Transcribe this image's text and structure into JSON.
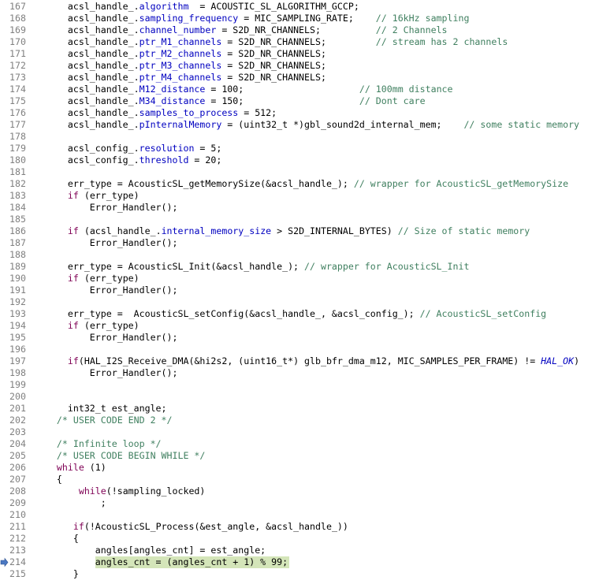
{
  "editor": {
    "active_line": "214",
    "lines": [
      {
        "num": "167",
        "tokens": [
          [
            "      acsl_handle_.",
            "plain"
          ],
          [
            "algorithm",
            "field"
          ],
          [
            "  = ACOUSTIC_SL_ALGORITHM_GCCP;",
            "plain"
          ]
        ]
      },
      {
        "num": "168",
        "tokens": [
          [
            "      acsl_handle_.",
            "plain"
          ],
          [
            "sampling_frequency",
            "field"
          ],
          [
            " = MIC_SAMPLING_RATE;    ",
            "plain"
          ],
          [
            "// 16kHz sampling",
            "comment"
          ]
        ]
      },
      {
        "num": "169",
        "tokens": [
          [
            "      acsl_handle_.",
            "plain"
          ],
          [
            "channel_number",
            "field"
          ],
          [
            " = S2D_NR_CHANNELS;          ",
            "plain"
          ],
          [
            "// 2 Channels",
            "comment"
          ]
        ]
      },
      {
        "num": "170",
        "tokens": [
          [
            "      acsl_handle_.",
            "plain"
          ],
          [
            "ptr_M1_channels",
            "field"
          ],
          [
            " = S2D_NR_CHANNELS;         ",
            "plain"
          ],
          [
            "// stream has 2 channels",
            "comment"
          ]
        ]
      },
      {
        "num": "171",
        "tokens": [
          [
            "      acsl_handle_.",
            "plain"
          ],
          [
            "ptr_M2_channels",
            "field"
          ],
          [
            " = S2D_NR_CHANNELS;",
            "plain"
          ]
        ]
      },
      {
        "num": "172",
        "tokens": [
          [
            "      acsl_handle_.",
            "plain"
          ],
          [
            "ptr_M3_channels",
            "field"
          ],
          [
            " = S2D_NR_CHANNELS;",
            "plain"
          ]
        ]
      },
      {
        "num": "173",
        "tokens": [
          [
            "      acsl_handle_.",
            "plain"
          ],
          [
            "ptr_M4_channels",
            "field"
          ],
          [
            " = S2D_NR_CHANNELS;",
            "plain"
          ]
        ]
      },
      {
        "num": "174",
        "tokens": [
          [
            "      acsl_handle_.",
            "plain"
          ],
          [
            "M12_distance",
            "field"
          ],
          [
            " = 100;                     ",
            "plain"
          ],
          [
            "// 100mm distance",
            "comment"
          ]
        ]
      },
      {
        "num": "175",
        "tokens": [
          [
            "      acsl_handle_.",
            "plain"
          ],
          [
            "M34_distance",
            "field"
          ],
          [
            " = 150;                     ",
            "plain"
          ],
          [
            "// Dont care",
            "comment"
          ]
        ]
      },
      {
        "num": "176",
        "tokens": [
          [
            "      acsl_handle_.",
            "plain"
          ],
          [
            "samples_to_process",
            "field"
          ],
          [
            " = 512;",
            "plain"
          ]
        ]
      },
      {
        "num": "177",
        "tokens": [
          [
            "      acsl_handle_.",
            "plain"
          ],
          [
            "pInternalMemory",
            "field"
          ],
          [
            " = (uint32_t *)gbl_sound2d_internal_mem;    ",
            "plain"
          ],
          [
            "// some static memory",
            "comment"
          ]
        ]
      },
      {
        "num": "178",
        "tokens": []
      },
      {
        "num": "179",
        "tokens": [
          [
            "      acsl_config_.",
            "plain"
          ],
          [
            "resolution",
            "field"
          ],
          [
            " = 5;",
            "plain"
          ]
        ]
      },
      {
        "num": "180",
        "tokens": [
          [
            "      acsl_config_.",
            "plain"
          ],
          [
            "threshold",
            "field"
          ],
          [
            " = 20;",
            "plain"
          ]
        ]
      },
      {
        "num": "181",
        "tokens": []
      },
      {
        "num": "182",
        "tokens": [
          [
            "      err_type = AcousticSL_getMemorySize(&acsl_handle_); ",
            "plain"
          ],
          [
            "// wrapper for AcousticSL_getMemorySize",
            "comment"
          ]
        ]
      },
      {
        "num": "183",
        "tokens": [
          [
            "      ",
            "plain"
          ],
          [
            "if",
            "keyword"
          ],
          [
            " (err_type)",
            "plain"
          ]
        ]
      },
      {
        "num": "184",
        "tokens": [
          [
            "          Error_Handler();",
            "plain"
          ]
        ]
      },
      {
        "num": "185",
        "tokens": []
      },
      {
        "num": "186",
        "tokens": [
          [
            "      ",
            "plain"
          ],
          [
            "if",
            "keyword"
          ],
          [
            " (acsl_handle_.",
            "plain"
          ],
          [
            "internal_memory_size",
            "field"
          ],
          [
            " > S2D_INTERNAL_BYTES) ",
            "plain"
          ],
          [
            "// Size of static memory",
            "comment"
          ]
        ]
      },
      {
        "num": "187",
        "tokens": [
          [
            "          Error_Handler();",
            "plain"
          ]
        ]
      },
      {
        "num": "188",
        "tokens": []
      },
      {
        "num": "189",
        "tokens": [
          [
            "      err_type = AcousticSL_Init(&acsl_handle_); ",
            "plain"
          ],
          [
            "// wrapper for AcousticSL_Init",
            "comment"
          ]
        ]
      },
      {
        "num": "190",
        "tokens": [
          [
            "      ",
            "plain"
          ],
          [
            "if",
            "keyword"
          ],
          [
            " (err_type)",
            "plain"
          ]
        ]
      },
      {
        "num": "191",
        "tokens": [
          [
            "          Error_Handler();",
            "plain"
          ]
        ]
      },
      {
        "num": "192",
        "tokens": []
      },
      {
        "num": "193",
        "tokens": [
          [
            "      err_type =  AcousticSL_setConfig(&acsl_handle_, &acsl_config_); ",
            "plain"
          ],
          [
            "// AcousticSL_setConfig",
            "comment"
          ]
        ]
      },
      {
        "num": "194",
        "tokens": [
          [
            "      ",
            "plain"
          ],
          [
            "if",
            "keyword"
          ],
          [
            " (err_type)",
            "plain"
          ]
        ]
      },
      {
        "num": "195",
        "tokens": [
          [
            "          Error_Handler();",
            "plain"
          ]
        ]
      },
      {
        "num": "196",
        "tokens": []
      },
      {
        "num": "197",
        "tokens": [
          [
            "      ",
            "plain"
          ],
          [
            "if",
            "keyword"
          ],
          [
            "(HAL_I2S_Receive_DMA(&hi2s2, (uint16_t*) glb_bfr_dma_m12, MIC_SAMPLES_PER_FRAME) != ",
            "plain"
          ],
          [
            "HAL_OK",
            "ital"
          ],
          [
            ")",
            "plain"
          ]
        ]
      },
      {
        "num": "198",
        "tokens": [
          [
            "          Error_Handler();",
            "plain"
          ]
        ]
      },
      {
        "num": "199",
        "tokens": []
      },
      {
        "num": "200",
        "tokens": []
      },
      {
        "num": "201",
        "tokens": [
          [
            "      int32_t est_angle;",
            "plain"
          ]
        ]
      },
      {
        "num": "202",
        "tokens": [
          [
            "    ",
            "plain"
          ],
          [
            "/* USER CODE END 2 */",
            "comment"
          ]
        ]
      },
      {
        "num": "203",
        "tokens": []
      },
      {
        "num": "204",
        "tokens": [
          [
            "    ",
            "plain"
          ],
          [
            "/* Infinite loop */",
            "comment"
          ]
        ]
      },
      {
        "num": "205",
        "tokens": [
          [
            "    ",
            "plain"
          ],
          [
            "/* USER CODE BEGIN WHILE */",
            "comment"
          ]
        ]
      },
      {
        "num": "206",
        "tokens": [
          [
            "    ",
            "plain"
          ],
          [
            "while",
            "keyword"
          ],
          [
            " (1)",
            "plain"
          ]
        ]
      },
      {
        "num": "207",
        "tokens": [
          [
            "    {",
            "plain"
          ]
        ]
      },
      {
        "num": "208",
        "tokens": [
          [
            "        ",
            "plain"
          ],
          [
            "while",
            "keyword"
          ],
          [
            "(!sampling_locked)",
            "plain"
          ]
        ]
      },
      {
        "num": "209",
        "tokens": [
          [
            "            ;",
            "plain"
          ]
        ]
      },
      {
        "num": "210",
        "tokens": []
      },
      {
        "num": "211",
        "tokens": [
          [
            "       ",
            "plain"
          ],
          [
            "if",
            "keyword"
          ],
          [
            "(!AcousticSL_Process(&est_angle, &acsl_handle_))",
            "plain"
          ]
        ]
      },
      {
        "num": "212",
        "tokens": [
          [
            "       {",
            "plain"
          ]
        ]
      },
      {
        "num": "213",
        "tokens": [
          [
            "           angles[angles_cnt] = est_angle;",
            "plain"
          ]
        ]
      },
      {
        "num": "214",
        "tokens": [
          [
            "           angles_cnt = (angles_cnt + 1) % 99;",
            "plain"
          ]
        ]
      },
      {
        "num": "215",
        "tokens": [
          [
            "       }",
            "plain"
          ]
        ]
      }
    ]
  },
  "colors": {
    "plain": "#000000",
    "field": "#0000c0",
    "comment": "#3f7f5f",
    "keyword": "#7f0055",
    "ital": "#0000c0",
    "line_number": "#808080",
    "current_line_highlight": "#d4e5b9",
    "debug_marker": "#4a78c2"
  },
  "icons": {
    "active_line_marker": "instruction-pointer-arrow-icon"
  }
}
